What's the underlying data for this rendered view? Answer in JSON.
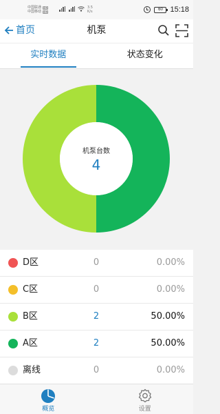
{
  "status_bar": {
    "carrier1": "中国联通",
    "carrier2": "中国移动",
    "hd": "HD",
    "net_speed_value": "3.5",
    "net_speed_unit": "K/s",
    "battery": "60",
    "time": "15:18"
  },
  "header": {
    "back_label": "首页",
    "title": "机泵"
  },
  "tabs": [
    {
      "label": "实时数据",
      "active": true
    },
    {
      "label": "状态变化",
      "active": false
    }
  ],
  "chart_data": {
    "type": "pie",
    "donut": true,
    "center_label": "机泵台数",
    "center_value": "4",
    "slices": [
      {
        "name": "D区",
        "count": 0,
        "percent": 0.0,
        "color": "#f05454"
      },
      {
        "name": "C区",
        "count": 0,
        "percent": 0.0,
        "color": "#f4bf2a"
      },
      {
        "name": "B区",
        "count": 2,
        "percent": 50.0,
        "color": "#a9e03a"
      },
      {
        "name": "A区",
        "count": 2,
        "percent": 50.0,
        "color": "#14b45a"
      },
      {
        "name": "离线",
        "count": 0,
        "percent": 0.0,
        "color": "#dcdcdc"
      }
    ]
  },
  "legend": [
    {
      "name": "D区",
      "count": "0",
      "percent": "0.00%",
      "color": "#f05454",
      "highlight": false
    },
    {
      "name": "C区",
      "count": "0",
      "percent": "0.00%",
      "color": "#f4bf2a",
      "highlight": false
    },
    {
      "name": "B区",
      "count": "2",
      "percent": "50.00%",
      "color": "#a9e03a",
      "highlight": true
    },
    {
      "name": "A区",
      "count": "2",
      "percent": "50.00%",
      "color": "#14b45a",
      "highlight": true
    },
    {
      "name": "离线",
      "count": "0",
      "percent": "0.00%",
      "color": "#dcdcdc",
      "highlight": false
    }
  ],
  "bottom_nav": [
    {
      "label": "概览",
      "icon": "pie-chart-icon",
      "active": true
    },
    {
      "label": "设置",
      "icon": "gear-icon",
      "active": false
    }
  ],
  "colors": {
    "accent": "#1f7fc0"
  }
}
